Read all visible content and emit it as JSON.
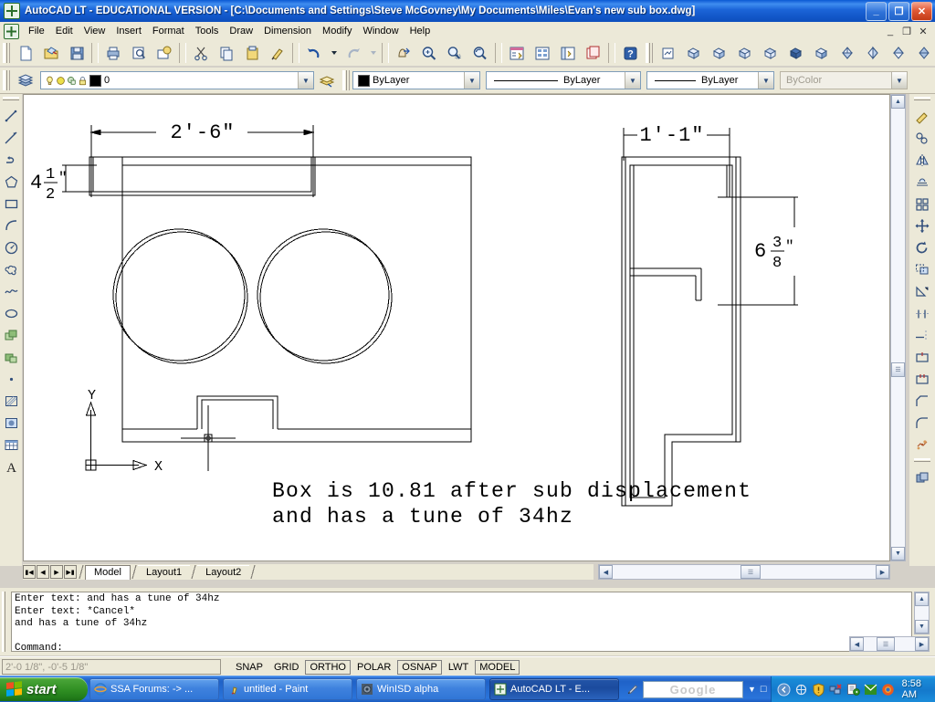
{
  "window": {
    "title": "AutoCAD LT - EDUCATIONAL VERSION - [C:\\Documents and Settings\\Steve McGovney\\My Documents\\Miles\\Evan's new sub box.dwg]",
    "minimize_label": "_",
    "restore_label": "❐",
    "close_label": "✕",
    "mdi_minimize": "_",
    "mdi_restore": "❐",
    "mdi_close": "✕"
  },
  "menu": {
    "items": [
      {
        "label": "File"
      },
      {
        "label": "Edit"
      },
      {
        "label": "View"
      },
      {
        "label": "Insert"
      },
      {
        "label": "Format"
      },
      {
        "label": "Tools"
      },
      {
        "label": "Draw"
      },
      {
        "label": "Dimension"
      },
      {
        "label": "Modify"
      },
      {
        "label": "Window"
      },
      {
        "label": "Help"
      }
    ]
  },
  "standard_toolbar": {
    "buttons": [
      {
        "name": "new-icon",
        "tip": "New"
      },
      {
        "name": "open-icon",
        "tip": "Open"
      },
      {
        "name": "save-icon",
        "tip": "Save"
      },
      {
        "name": "print-icon",
        "tip": "Plot"
      },
      {
        "name": "print-preview-icon",
        "tip": "Plot Preview"
      },
      {
        "name": "publish-icon",
        "tip": "Publish"
      },
      {
        "name": "cut-icon",
        "tip": "Cut"
      },
      {
        "name": "copy-icon",
        "tip": "Copy"
      },
      {
        "name": "paste-icon",
        "tip": "Paste"
      },
      {
        "name": "match-properties-icon",
        "tip": "Match Properties"
      },
      {
        "name": "undo-icon",
        "tip": "Undo"
      },
      {
        "name": "undo-dropdown-icon",
        "tip": "Undo history"
      },
      {
        "name": "redo-icon",
        "tip": "Redo"
      },
      {
        "name": "redo-dropdown-icon",
        "tip": "Redo history"
      },
      {
        "name": "pan-realtime-icon",
        "tip": "Pan Realtime"
      },
      {
        "name": "zoom-realtime-icon",
        "tip": "Zoom Realtime"
      },
      {
        "name": "zoom-window-icon",
        "tip": "Zoom Window"
      },
      {
        "name": "zoom-previous-icon",
        "tip": "Zoom Previous"
      },
      {
        "name": "properties-icon",
        "tip": "Properties"
      },
      {
        "name": "designcenter-icon",
        "tip": "DesignCenter"
      },
      {
        "name": "tool-palettes-icon",
        "tip": "Tool Palettes"
      },
      {
        "name": "sheet-set-icon",
        "tip": "Sheet Set Manager"
      },
      {
        "name": "markup-set-icon",
        "tip": "Markup Set Manager"
      },
      {
        "name": "help-icon",
        "tip": "Help"
      }
    ]
  },
  "view_toolbar": {
    "buttons": [
      {
        "name": "named-views-icon",
        "tip": "Named Views"
      },
      {
        "name": "sw-isometric-icon",
        "tip": "SW Isometric"
      },
      {
        "name": "se-isometric-icon",
        "tip": "SE Isometric"
      },
      {
        "name": "ne-isometric-icon",
        "tip": "NE Isometric"
      },
      {
        "name": "nw-isometric-icon",
        "tip": "NW Isometric"
      },
      {
        "name": "top-view-icon",
        "tip": "Top View"
      },
      {
        "name": "bottom-view-icon",
        "tip": "Bottom View"
      },
      {
        "name": "front-view-icon",
        "tip": "Front View"
      },
      {
        "name": "back-view-icon",
        "tip": "Back View"
      },
      {
        "name": "left-view-icon",
        "tip": "Left View"
      },
      {
        "name": "right-view-icon",
        "tip": "Right View"
      }
    ],
    "viewport_combo_value": ""
  },
  "layer_toolbar": {
    "layers_dialog_icon": "layers-icon",
    "layer_state_icon": "layer-states-icon",
    "current_layer": "0",
    "on_icon": "lightbulb-icon",
    "freeze_icon": "sun-icon",
    "freeze_vp_icon": "freeze-viewport-icon",
    "lock_icon": "padlock-icon",
    "color_swatch": "#000000"
  },
  "properties_toolbar": {
    "color_value": "ByLayer",
    "linetype_value": "ByLayer",
    "lineweight_value": "ByLayer",
    "plotstyle_value": "ByColor",
    "color_swatch": "#000000"
  },
  "draw_toolbar": {
    "buttons": [
      {
        "name": "line-icon",
        "tip": "Line"
      },
      {
        "name": "construction-line-icon",
        "tip": "Construction Line"
      },
      {
        "name": "polyline-icon",
        "tip": "Polyline"
      },
      {
        "name": "polygon-icon",
        "tip": "Polygon"
      },
      {
        "name": "rectangle-icon",
        "tip": "Rectangle"
      },
      {
        "name": "arc-icon",
        "tip": "Arc"
      },
      {
        "name": "circle-icon",
        "tip": "Circle"
      },
      {
        "name": "revision-cloud-icon",
        "tip": "Revision Cloud"
      },
      {
        "name": "spline-icon",
        "tip": "Spline"
      },
      {
        "name": "ellipse-icon",
        "tip": "Ellipse"
      },
      {
        "name": "insert-block-icon",
        "tip": "Insert Block"
      },
      {
        "name": "make-block-icon",
        "tip": "Make Block"
      },
      {
        "name": "point-icon",
        "tip": "Point"
      },
      {
        "name": "hatch-icon",
        "tip": "Hatch"
      },
      {
        "name": "gradient-icon",
        "tip": "Gradient"
      },
      {
        "name": "table-icon",
        "tip": "Table"
      },
      {
        "name": "multiline-text-icon",
        "tip": "Multiline Text"
      }
    ]
  },
  "modify_toolbar": {
    "buttons": [
      {
        "name": "erase-icon",
        "tip": "Erase"
      },
      {
        "name": "copy-object-icon",
        "tip": "Copy Object"
      },
      {
        "name": "mirror-icon",
        "tip": "Mirror"
      },
      {
        "name": "offset-icon",
        "tip": "Offset"
      },
      {
        "name": "array-icon",
        "tip": "Array"
      },
      {
        "name": "move-icon",
        "tip": "Move"
      },
      {
        "name": "rotate-icon",
        "tip": "Rotate"
      },
      {
        "name": "scale-icon",
        "tip": "Scale"
      },
      {
        "name": "stretch-icon",
        "tip": "Stretch"
      },
      {
        "name": "trim-icon",
        "tip": "Trim"
      },
      {
        "name": "extend-icon",
        "tip": "Extend"
      },
      {
        "name": "break-at-point-icon",
        "tip": "Break at Point"
      },
      {
        "name": "break-icon",
        "tip": "Break"
      },
      {
        "name": "chamfer-icon",
        "tip": "Chamfer"
      },
      {
        "name": "fillet-icon",
        "tip": "Fillet"
      },
      {
        "name": "explode-icon",
        "tip": "Explode"
      }
    ]
  },
  "drawing": {
    "dimensions": {
      "top_width": "2'-6\"",
      "left_height_whole": "4",
      "left_height_num": "1",
      "left_height_den": "2",
      "left_height_unit": "″",
      "right_width": "1'-1\"",
      "right_height_whole": "6",
      "right_height_num": "3",
      "right_height_den": "8",
      "right_height_unit": "″"
    },
    "annotation": {
      "line1": "Box is 10.81 after sub displacement",
      "line2": "and has a tune of 34hz"
    },
    "ucs": {
      "x_label": "X",
      "y_label": "Y"
    }
  },
  "layout_tabs": {
    "nav_first": "⏪",
    "nav_prev": "◀",
    "nav_next": "▶",
    "nav_last": "⏩",
    "tabs": [
      {
        "label": "Model",
        "active": true
      },
      {
        "label": "Layout1",
        "active": false
      },
      {
        "label": "Layout2",
        "active": false
      }
    ]
  },
  "command_window": {
    "lines": [
      "Enter text: and has a tune of 34hz",
      "Enter text: *Cancel*",
      "and has a tune of 34hz",
      "",
      "Command:"
    ]
  },
  "status_bar": {
    "coordinates": "2'-0 1/8\", -0'-5 1/8\"",
    "toggles": [
      {
        "label": "SNAP",
        "on": false
      },
      {
        "label": "GRID",
        "on": false
      },
      {
        "label": "ORTHO",
        "on": true
      },
      {
        "label": "POLAR",
        "on": false
      },
      {
        "label": "OSNAP",
        "on": true
      },
      {
        "label": "LWT",
        "on": false
      },
      {
        "label": "MODEL",
        "on": true
      }
    ]
  },
  "taskbar": {
    "start_label": "start",
    "items": [
      {
        "label": "SSA Forums: -> ...",
        "icon": "internet-explorer-icon",
        "active": false
      },
      {
        "label": "untitled - Paint",
        "icon": "paint-icon",
        "active": false
      },
      {
        "label": "WinISD alpha",
        "icon": "winisd-icon",
        "active": false
      },
      {
        "label": "AutoCAD LT - E...",
        "icon": "autocad-icon",
        "active": true
      }
    ],
    "google": {
      "text": "Google",
      "dropdown": "▼",
      "button": "□"
    },
    "tray": {
      "icons": [
        "show-hidden-icons-icon",
        "network-icon",
        "security-alert-icon",
        "network-disconnected-icon",
        "update-icon",
        "messenger-icon",
        "firefox-icon"
      ],
      "time": "8:58 AM"
    }
  },
  "colors": {
    "titlebar_blue": "#1b64d8",
    "toolbar_face": "#ece9d8",
    "canvas_bg": "#ffffff",
    "line_color": "#000000",
    "taskbar_blue": "#2a6ed0",
    "start_green": "#2f8e22"
  }
}
